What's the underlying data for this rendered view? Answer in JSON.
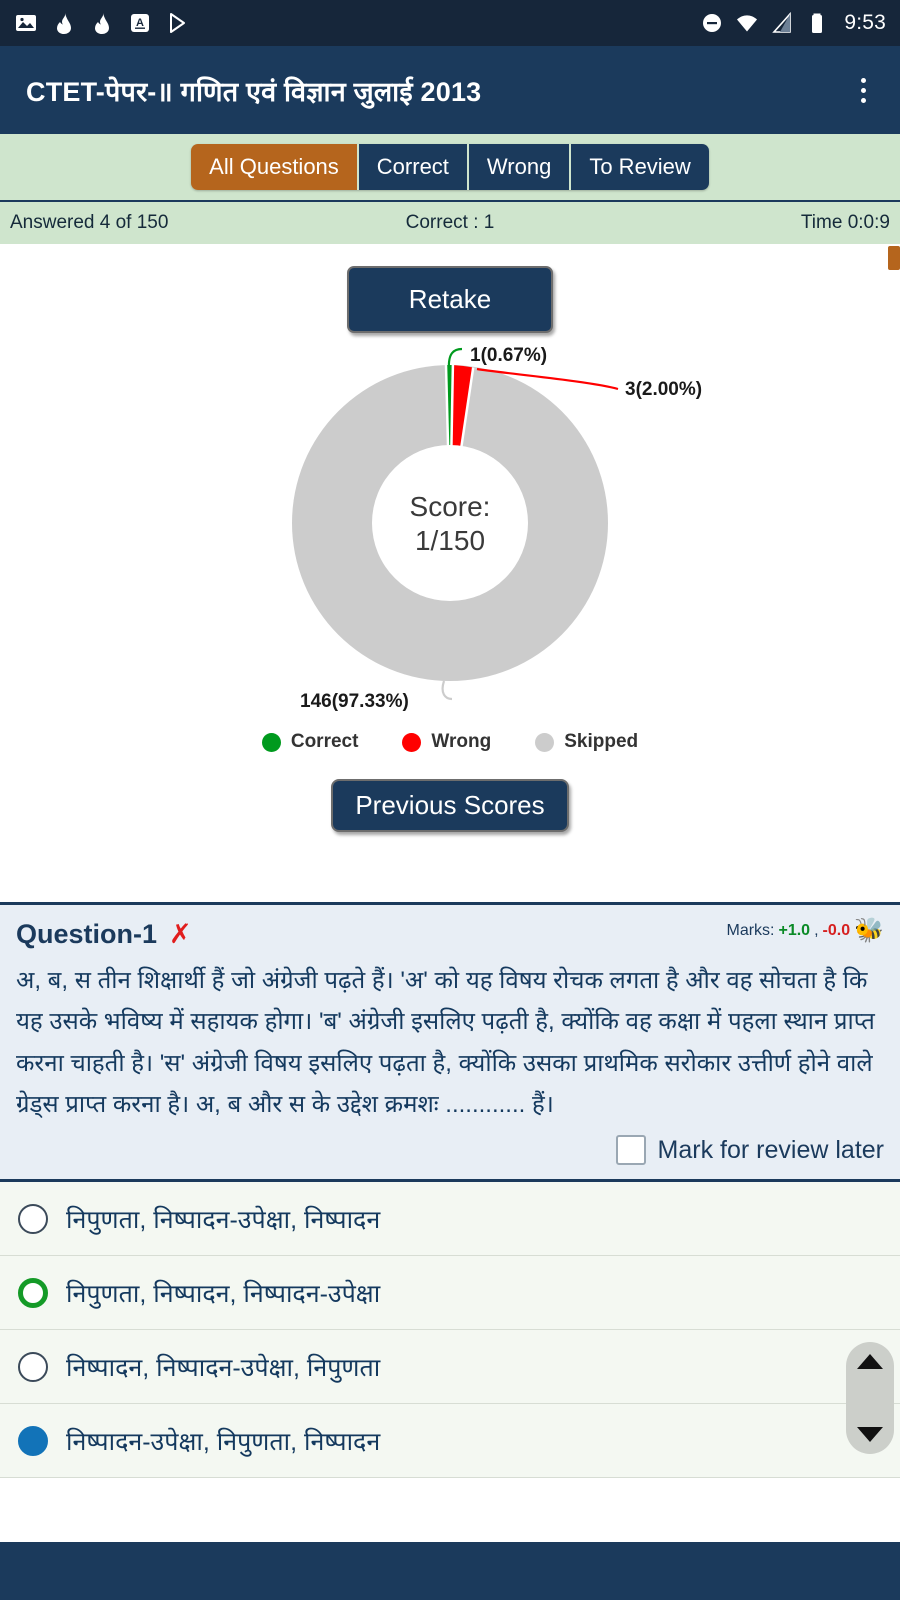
{
  "status_bar": {
    "time": "9:53",
    "left_icons": [
      "image-icon",
      "flame-icon",
      "flame-icon",
      "a-translate-icon",
      "play-store-icon"
    ],
    "right_icons": [
      "dnd-icon",
      "wifi-icon",
      "signal-icon",
      "battery-icon"
    ]
  },
  "app_bar": {
    "title": "CTET-पेपर-॥ गणित एवं विज्ञान जुलाई 2013",
    "overflow_icon": "kebab-menu-icon"
  },
  "tabs": [
    {
      "label": "All Questions",
      "active": true
    },
    {
      "label": "Correct",
      "active": false
    },
    {
      "label": "Wrong",
      "active": false
    },
    {
      "label": "To Review",
      "active": false
    }
  ],
  "summary": {
    "answered": "Answered 4 of 150",
    "correct": "Correct : 1",
    "time": "Time 0:0:9"
  },
  "actions": {
    "retake_label": "Retake",
    "previous_scores_label": "Previous Scores"
  },
  "chart_data": {
    "type": "pie",
    "title": "",
    "center_label_line1": "Score:",
    "center_label_line2": "1/150",
    "categories": [
      "Correct",
      "Wrong",
      "Skipped"
    ],
    "values": [
      1,
      3,
      146
    ],
    "percentages": [
      0.67,
      2.0,
      97.33
    ],
    "data_labels": [
      "1(0.67%)",
      "3(2.00%)",
      "146(97.33%)"
    ],
    "colors": [
      "#009a1e",
      "#ff0000",
      "#cccccc"
    ],
    "legend": [
      "Correct",
      "Wrong",
      "Skipped"
    ],
    "legend_position": "bottom",
    "total": 150,
    "donut": true
  },
  "question": {
    "title": "Question-1",
    "status_icon": "wrong-cross-icon",
    "marks_label": "Marks:",
    "marks_positive": "+1.0",
    "marks_separator": ",",
    "marks_negative": "-0.0",
    "report_icon": "bug-icon",
    "text": "अ, ब, स तीन शिक्षार्थी हैं जो अंग्रेजी पढ़ते हैं। 'अ' को यह विषय रोचक लगता है और वह सोचता है कि यह उसके भविष्य में सहायक होगा। 'ब' अंग्रेजी इसलिए पढ़ती है, क्योंकि वह कक्षा में पहला स्थान प्राप्त करना चाहती है। 'स' अंग्रेजी विषय इसलिए पढ़ता है, क्योंकि उसका प्राथमिक सरोकार उत्तीर्ण होने वाले ग्रेड्स प्राप्त करना है। अ, ब और स के उद्देश क्रमशः ............ हैं।",
    "review_label": "Mark for review later",
    "review_checked": false,
    "options": [
      {
        "text": "निपुणता, निष्पादन-उपेक्षा, निष्पादन",
        "state": "none"
      },
      {
        "text": "निपुणता, निष्पादन, निष्पादन-उपेक्षा",
        "state": "correct"
      },
      {
        "text": "निष्पादन, निष्पादन-उपेक्षा, निपुणता",
        "state": "none"
      },
      {
        "text": "निष्पादन-उपेक्षा, निपुणता, निष्पादन",
        "state": "selected"
      }
    ]
  },
  "scrollbar": {
    "up_icon": "scroll-up-arrow-icon",
    "down_icon": "scroll-down-arrow-icon"
  }
}
